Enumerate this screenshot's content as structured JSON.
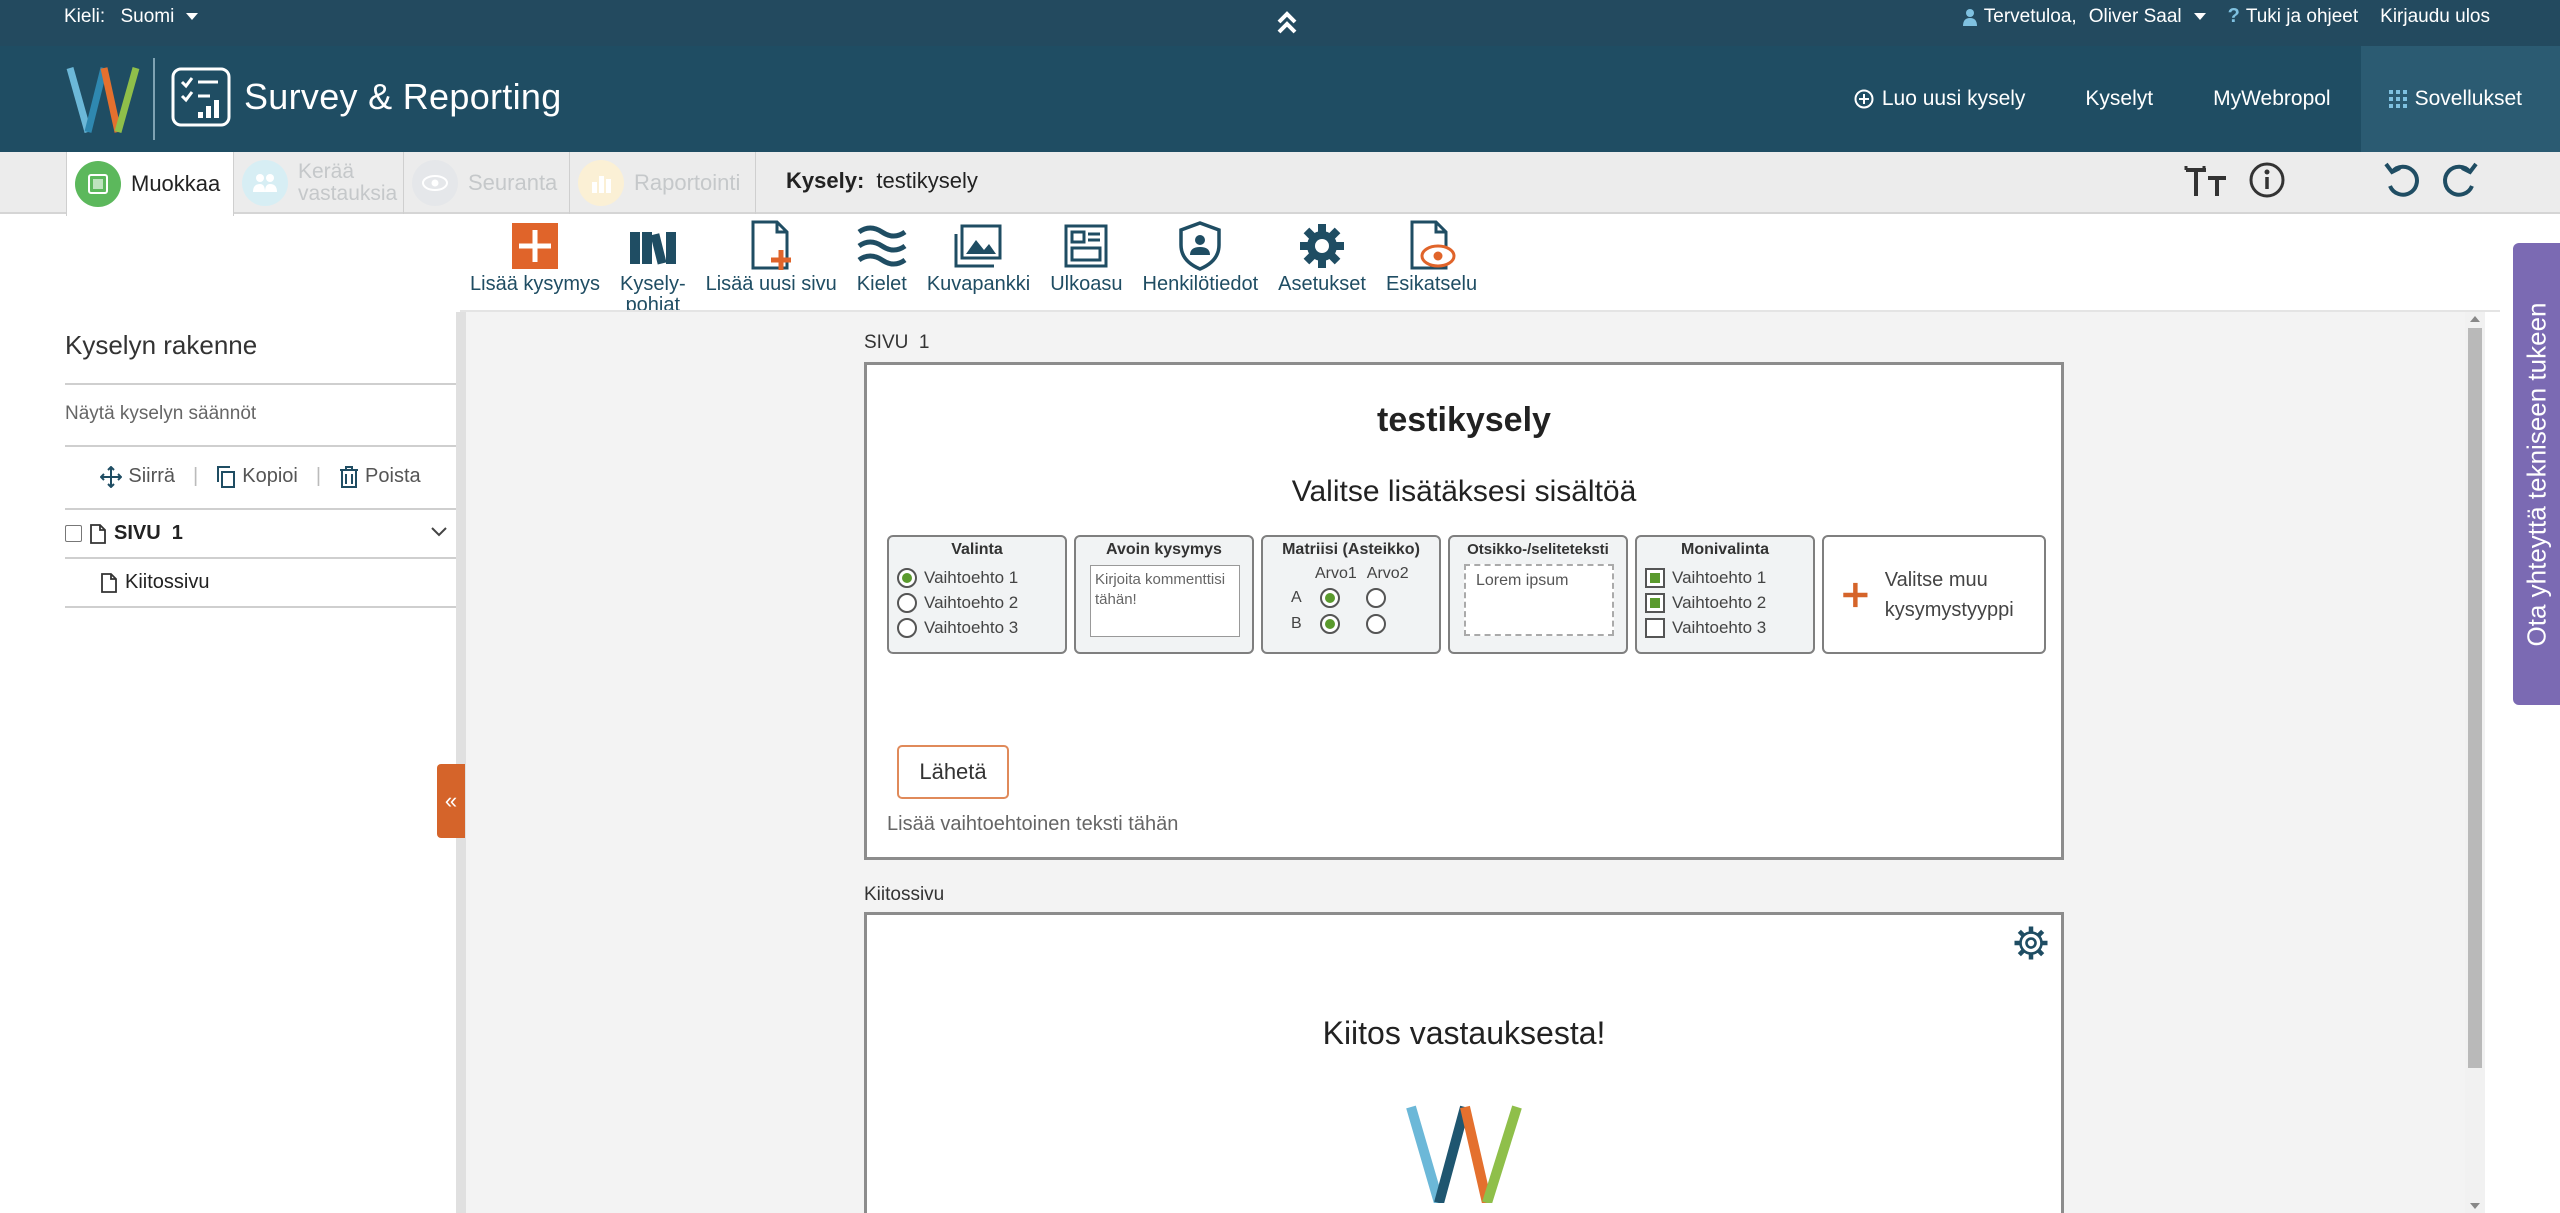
{
  "topbar": {
    "lang_label": "Kieli:",
    "lang_value": "Suomi",
    "welcome": "Tervetuloa,",
    "user": "Oliver Saal",
    "help": "Tuki ja ohjeet",
    "logout": "Kirjaudu ulos"
  },
  "header": {
    "app_title": "Survey & Reporting",
    "nav": {
      "new_survey": "Luo uusi kysely",
      "surveys": "Kyselyt",
      "mywebropol": "MyWebropol",
      "apps": "Sovellukset"
    }
  },
  "tabs": {
    "edit": "Muokkaa",
    "collect_1": "Kerää",
    "collect_2": "vastauksia",
    "monitor": "Seuranta",
    "report": "Raportointi",
    "survey_label": "Kysely:",
    "survey_name": "testikysely"
  },
  "toolbar": {
    "add_question": "Lisää kysymys",
    "templates_1": "Kysely-",
    "templates_2": "pohjat",
    "add_page": "Lisää uusi sivu",
    "languages": "Kielet",
    "image_bank": "Kuvapankki",
    "layout": "Ulkoasu",
    "personal_data": "Henkilötiedot",
    "settings": "Asetukset",
    "preview": "Esikatselu"
  },
  "left_panel": {
    "title": "Kyselyn rakenne",
    "show_rules": "Näytä kyselyn säännöt",
    "move": "Siirrä",
    "copy": "Kopioi",
    "delete": "Poista",
    "page1": "SIVU  1",
    "thanks_page": "Kiitossivu"
  },
  "page1": {
    "label": "SIVU  1",
    "title": "testikysely",
    "choose_text": "Valitse lisätäksesi sisältöä",
    "qtypes": {
      "choice": {
        "title": "Valinta",
        "options": [
          "Vaihtoehto 1",
          "Vaihtoehto 2",
          "Vaihtoehto 3"
        ]
      },
      "open": {
        "title": "Avoin kysymys",
        "placeholder": "Kirjoita kommenttisi tähän!"
      },
      "matrix": {
        "title": "Matriisi (Asteikko)",
        "col1": "Arvo1",
        "col2": "Arvo2",
        "row1": "A",
        "row2": "B"
      },
      "heading": {
        "title": "Otsikko-/seliteteksti",
        "sample": "Lorem ipsum"
      },
      "multi": {
        "title": "Monivalinta",
        "options": [
          "Vaihtoehto 1",
          "Vaihtoehto 2",
          "Vaihtoehto 3"
        ]
      },
      "other": "Valitse muu kysymystyyppi"
    },
    "send": "Lähetä",
    "alt_text": "Lisää vaihtoehtoinen teksti tähän"
  },
  "thanks": {
    "label": "Kiitossivu",
    "text": "Kiitos vastauksesta!"
  },
  "support_tab": "Ota yhteyttä tekniseen tukeen",
  "colors": {
    "header_dark": "#1f4d63",
    "accent_orange": "#d5642a",
    "support_purple": "#7b6ab3",
    "green": "#5a9a2d"
  }
}
